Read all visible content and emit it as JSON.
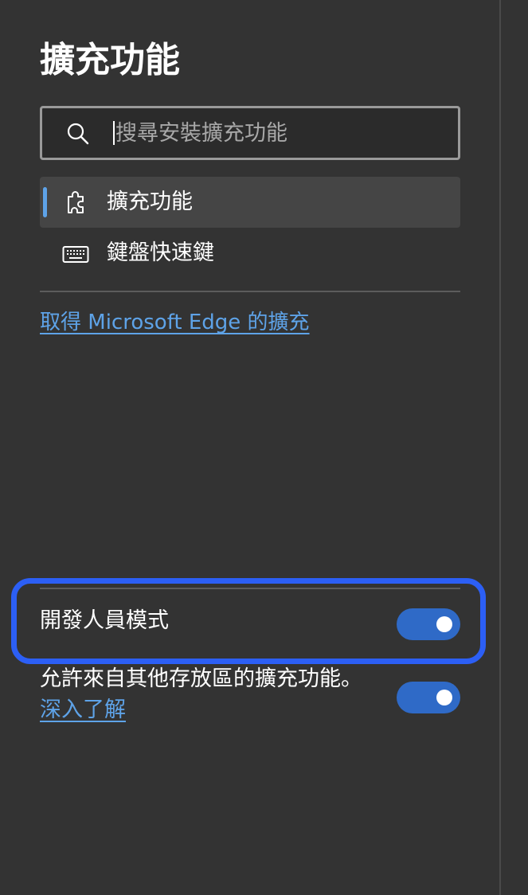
{
  "sidebar": {
    "title": "擴充功能",
    "search": {
      "placeholder": "搜尋安裝擴充功能",
      "value": "",
      "icon": "search-icon"
    },
    "nav": [
      {
        "label": "擴充功能",
        "icon": "puzzle-icon",
        "active": true
      },
      {
        "label": "鍵盤快速鍵",
        "icon": "keyboard-icon",
        "active": false
      }
    ],
    "store_link": "取得 Microsoft Edge 的擴充"
  },
  "settings": {
    "developer_mode": {
      "label": "開發人員模式",
      "enabled": true
    },
    "other_stores": {
      "label": "允許來自其他存放區的擴充功能。",
      "link": "深入了解",
      "enabled": true
    }
  },
  "colors": {
    "background": "#333333",
    "accent": "#5ea3e8",
    "toggle_on": "#2f6ac7",
    "highlight": "#2c5ff5"
  }
}
